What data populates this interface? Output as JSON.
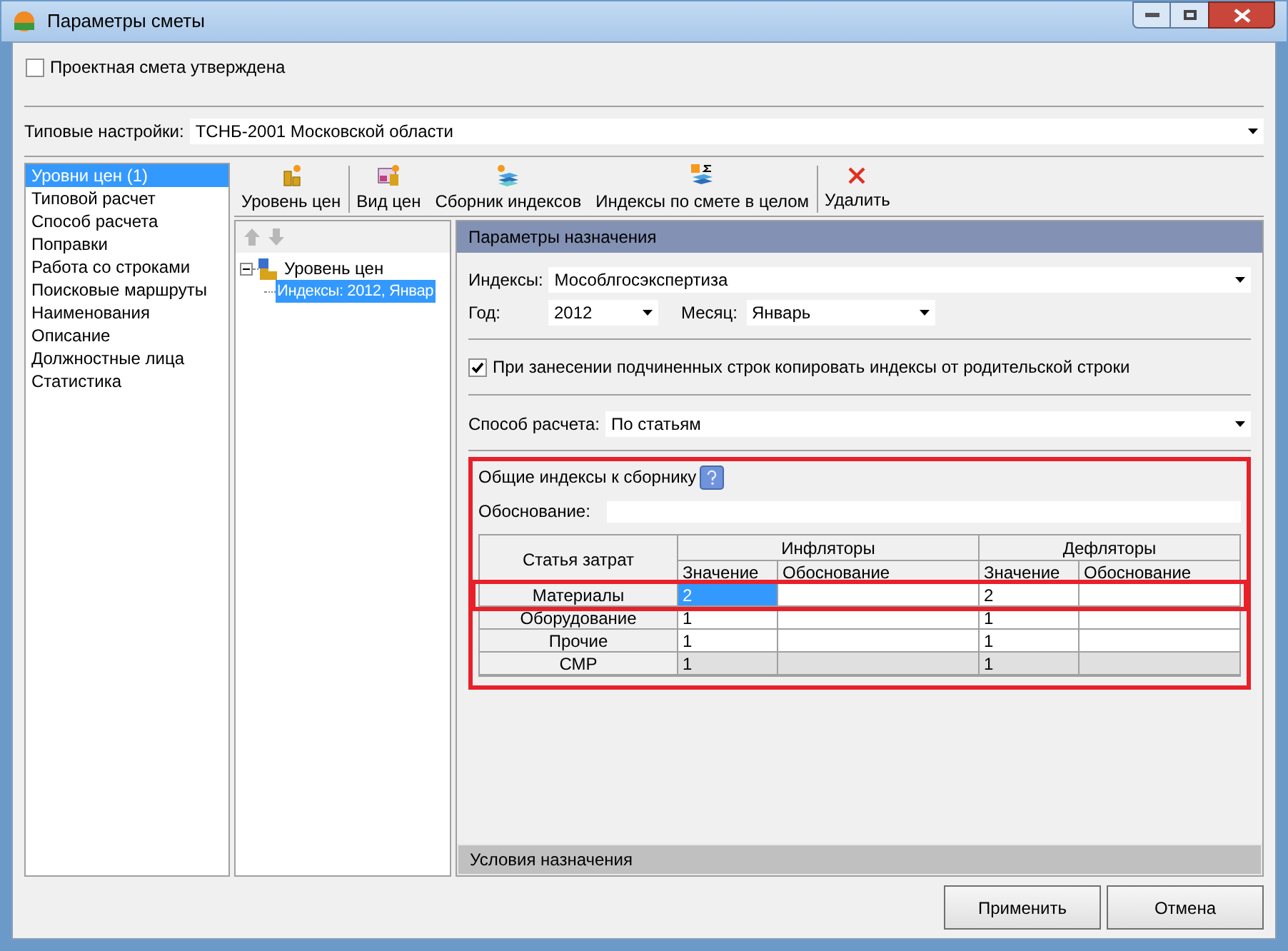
{
  "window": {
    "title": "Параметры сметы"
  },
  "approved": {
    "label": "Проектная смета утверждена",
    "checked": false
  },
  "preset": {
    "label": "Типовые настройки:",
    "value": "ТСНБ-2001 Московской области"
  },
  "sidebar": {
    "items": [
      {
        "label": "Уровни цен (1)",
        "selected": true
      },
      {
        "label": "Типовой расчет",
        "selected": false
      },
      {
        "label": "Способ расчета",
        "selected": false
      },
      {
        "label": "Поправки",
        "selected": false
      },
      {
        "label": "Работа со строками",
        "selected": false
      },
      {
        "label": "Поисковые маршруты",
        "selected": false
      },
      {
        "label": "Наименования",
        "selected": false
      },
      {
        "label": "Описание",
        "selected": false
      },
      {
        "label": "Должностные лица",
        "selected": false
      },
      {
        "label": "Статистика",
        "selected": false
      }
    ]
  },
  "toolbar": [
    {
      "label": "Уровень цен",
      "kind": "level"
    },
    {
      "label": "Вид цен",
      "kind": "pricetype"
    },
    {
      "label": "Сборник индексов",
      "kind": "books"
    },
    {
      "label": "Индексы по смете в целом",
      "kind": "sum"
    },
    {
      "label": "Удалить",
      "kind": "delete"
    }
  ],
  "tree": {
    "nodes": [
      {
        "label": "Уровень цен",
        "expanded": true,
        "selected": false,
        "children": [
          {
            "label": "Индексы: 2012, Январ",
            "selected": true
          }
        ]
      }
    ]
  },
  "panel": {
    "header": "Параметры назначения",
    "indexes": {
      "label": "Индексы:",
      "value": "Мособлгосэкспертиза"
    },
    "year": {
      "label": "Год:",
      "value": "2012"
    },
    "month": {
      "label": "Месяц:",
      "value": "Январь"
    },
    "copy": {
      "label": "При занесении подчиненных строк копировать индексы от родительской строки",
      "checked": true
    },
    "method": {
      "label": "Способ расчета:",
      "value": "По статьям"
    },
    "group": {
      "title": "Общие индексы к сборнику",
      "highlighted": true,
      "basis_label": "Обоснование:",
      "table": {
        "first": "Статья затрат",
        "groups": [
          "Инфляторы",
          "Дефляторы"
        ],
        "sub": [
          "Значение",
          "Обоснование",
          "Значение",
          "Обоснование"
        ],
        "rows": [
          {
            "name": "Материалы",
            "highlighted": true,
            "readonly": false,
            "cells": [
              {
                "value": "2",
                "selected": true
              },
              {
                "selected": false
              },
              {
                "value": "2",
                "selected": false
              },
              {
                "selected": false
              }
            ]
          },
          {
            "name": "Оборудование",
            "highlighted": false,
            "readonly": false,
            "cells": [
              {
                "value": "1",
                "selected": false
              },
              {
                "selected": false
              },
              {
                "value": "1",
                "selected": false
              },
              {
                "selected": false
              }
            ]
          },
          {
            "name": "Прочие",
            "highlighted": false,
            "readonly": false,
            "cells": [
              {
                "value": "1",
                "selected": false
              },
              {
                "selected": false
              },
              {
                "value": "1",
                "selected": false
              },
              {
                "selected": false
              }
            ]
          },
          {
            "name": "СМР",
            "highlighted": false,
            "readonly": true,
            "cells": [
              {
                "value": "1",
                "selected": false
              },
              {
                "selected": false
              },
              {
                "value": "1",
                "selected": false
              },
              {
                "selected": false
              }
            ]
          }
        ]
      }
    },
    "footer": "Условия назначения"
  },
  "buttons": [
    "Применить",
    "Отмена"
  ]
}
